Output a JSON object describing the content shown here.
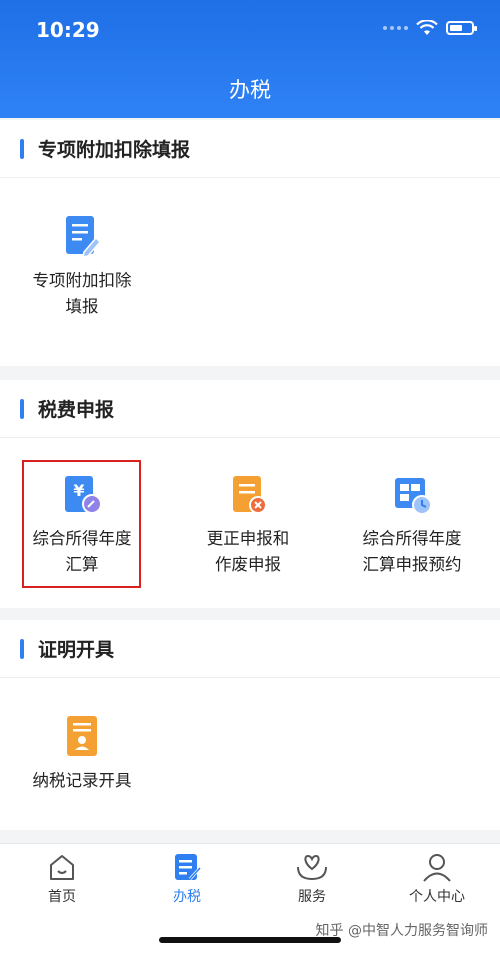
{
  "status_bar": {
    "time": "10:29",
    "battery_percent": 60
  },
  "page_title": "办税",
  "sections": [
    {
      "title": "专项附加扣除填报",
      "items": [
        {
          "label": "专项附加扣除\n填报",
          "icon": "document-edit-icon"
        }
      ]
    },
    {
      "title": "税费申报",
      "items": [
        {
          "label": "综合所得年度\n汇算",
          "icon": "yuan-document-icon",
          "highlighted": true
        },
        {
          "label": "更正申报和\n作废申报",
          "icon": "document-cancel-icon"
        },
        {
          "label": "综合所得年度\n汇算申报预约",
          "icon": "calendar-clock-icon"
        }
      ]
    },
    {
      "title": "证明开具",
      "items": [
        {
          "label": "纳税记录开具",
          "icon": "tax-record-icon"
        }
      ]
    }
  ],
  "bottom_nav": [
    {
      "label": "首页",
      "icon": "home-icon"
    },
    {
      "label": "办税",
      "icon": "tax-icon",
      "active": true
    },
    {
      "label": "服务",
      "icon": "service-heart-icon"
    },
    {
      "label": "个人中心",
      "icon": "person-icon"
    }
  ],
  "watermark": "知乎 @中智人力服务智询师",
  "colors": {
    "header": "#2f82f5",
    "accent": "#2f7ff0",
    "highlight": "#d92121",
    "orange": "#f5a033"
  }
}
